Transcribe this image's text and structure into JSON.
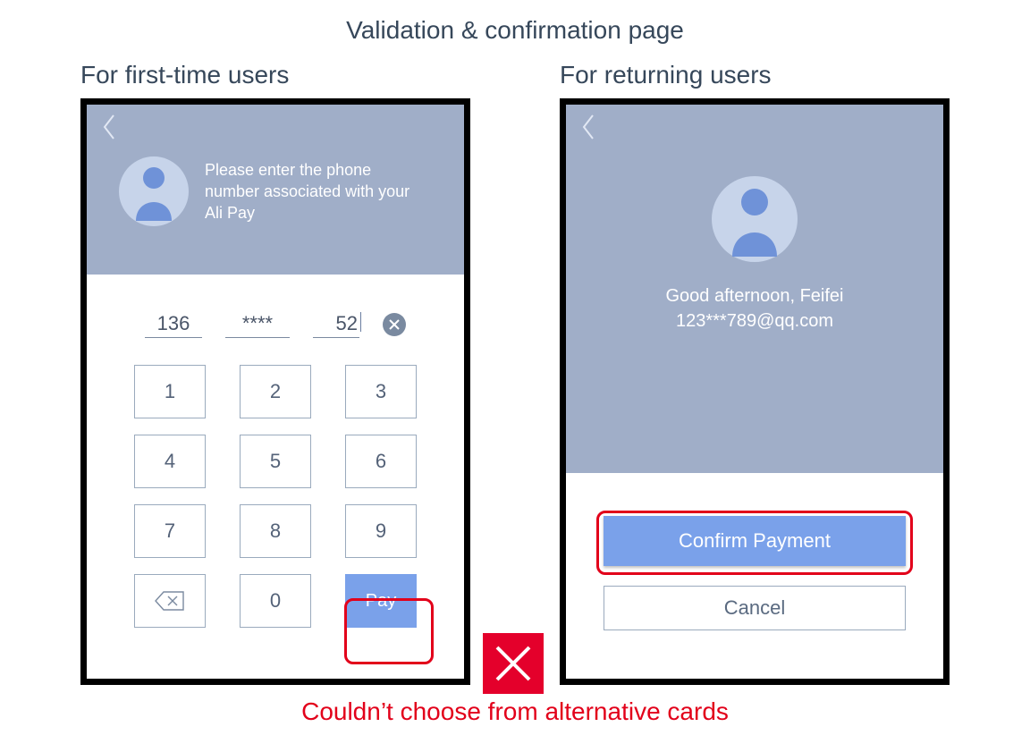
{
  "page_title": "Validation & confirmation page",
  "left": {
    "title": "For first-time users",
    "header_text": "Please enter the phone number associated with your Ali Pay",
    "input_seg1": "136",
    "input_seg2": "****",
    "input_seg3": "52",
    "keypad": [
      "1",
      "2",
      "3",
      "4",
      "5",
      "6",
      "7",
      "8",
      "9",
      "",
      "0",
      "Pay"
    ]
  },
  "right": {
    "title": "For returning users",
    "greeting": "Good afternoon, Feifei",
    "email": "123***789@qq.com",
    "confirm_label": "Confirm Payment",
    "cancel_label": "Cancel"
  },
  "footer": "Couldn’t choose from alternative cards"
}
